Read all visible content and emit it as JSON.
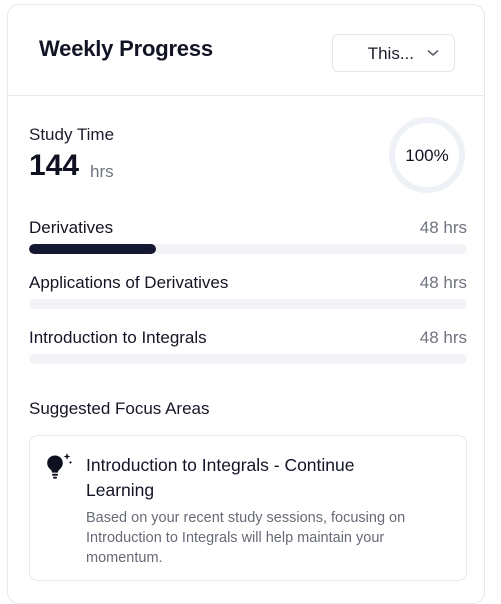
{
  "header": {
    "title": "Weekly Progress",
    "period_select": {
      "value": "This..."
    }
  },
  "study": {
    "label": "Study Time",
    "value": "144",
    "unit": "hrs",
    "completion_label": "100%",
    "completion_fraction": 1.0
  },
  "topics": [
    {
      "name": "Derivatives",
      "hours": "48 hrs",
      "progress_fraction": 0.29
    },
    {
      "name": "Applications of Derivatives",
      "hours": "48 hrs",
      "progress_fraction": 0.0
    },
    {
      "name": "Introduction to Integrals",
      "hours": "48 hrs",
      "progress_fraction": 0.0
    }
  ],
  "focus": {
    "heading": "Suggested Focus Areas",
    "items": [
      {
        "icon": "lightbulb-sparkle-icon",
        "title": "Introduction to Integrals - Continue Learning",
        "description": "Based on your recent study sessions, focusing on Introduction to Integrals will help maintain your momentum."
      }
    ]
  },
  "colors": {
    "bar_fill": "#151833",
    "bar_track": "#f1f3f6",
    "ring_track": "#eef1f5",
    "border": "#e6e8ec"
  }
}
